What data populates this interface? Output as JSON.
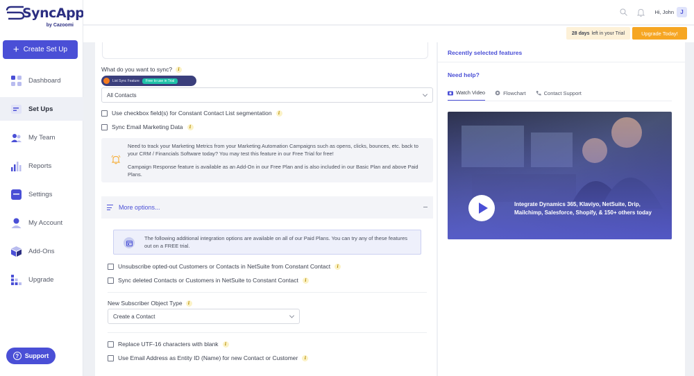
{
  "brand": {
    "name": "SyncApps",
    "byline": "by Cazoomi"
  },
  "sidebar": {
    "create_label": "Create Set Up",
    "items": [
      {
        "label": "Dashboard",
        "icon": "dashboard-icon"
      },
      {
        "label": "Set Ups",
        "icon": "setups-icon"
      },
      {
        "label": "My Team",
        "icon": "team-icon"
      },
      {
        "label": "Reports",
        "icon": "reports-icon"
      },
      {
        "label": "Settings",
        "icon": "settings-icon"
      },
      {
        "label": "My Account",
        "icon": "account-icon"
      },
      {
        "label": "Add-Ons",
        "icon": "addons-icon"
      },
      {
        "label": "Upgrade",
        "icon": "upgrade-icon"
      }
    ],
    "support_label": "Support"
  },
  "header": {
    "greeting": "Hi, John",
    "avatar_initial": "J"
  },
  "trial": {
    "days": "28 days",
    "text": "left in your Trial",
    "upgrade_label": "Upgrade Today!"
  },
  "form": {
    "question": "What do you want to sync?",
    "feature_pill": {
      "name": "List Sync Feature",
      "tag": "Free to use in Trial"
    },
    "sync_select": "All Contacts",
    "check_segmentation": "Use checkbox field(s) for Constant Contact List segmentation",
    "check_email_data": "Sync Email Marketing Data",
    "promo_line1": "Need to track your Marketing Metrics from your Marketing Automation Campaigns such as opens, clicks, bounces, etc. back to your CRM / Financials Software today? You may test this feature in our Free Trial for free!",
    "promo_line2": "Campaign Response feature is available as an Add-On in our Free Plan and is also included in our Basic Plan and above Paid Plans.",
    "more_options": "More options...",
    "paid_info": "The following additional integration options are available on all of our Paid Plans. You can try any of these features out on a FREE trial.",
    "check_unsubscribe": "Unsubscribe opted-out Customers or Contacts in NetSuite from Constant Contact",
    "check_sync_deleted": "Sync deleted Contacts or Customers in NetSuite to Constant Contact",
    "subscriber_label": "New Subscriber Object Type",
    "subscriber_select": "Create a Contact",
    "check_utf16": "Replace UTF-16 characters with blank",
    "check_entity_id": "Use Email Address as Entity ID (Name) for new Contact or Customer"
  },
  "side": {
    "recent_title": "Recently selected features",
    "help_title": "Need help?",
    "tabs": [
      "Watch Video",
      "Flowchart",
      "Contact Support"
    ],
    "video_caption": "Integrate Dynamics 365, Klaviyo, NetSuite, Drip, Mailchimp, Salesforce, Shopify, & 150+ others today"
  },
  "colors": {
    "accent": "#4a4fd6",
    "upgrade": "#f6a623",
    "trial_bg": "#fdf1d8",
    "free_tag": "#1fc2a8"
  }
}
